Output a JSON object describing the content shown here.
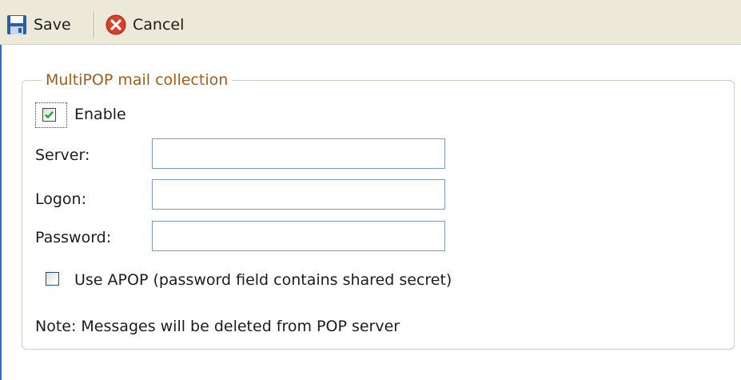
{
  "toolbar": {
    "save_label": "Save",
    "cancel_label": "Cancel"
  },
  "section": {
    "legend": "MultiPOP mail collection"
  },
  "enable": {
    "label": "Enable",
    "checked": true
  },
  "server": {
    "label": "Server:",
    "value": ""
  },
  "logon": {
    "label": "Logon:",
    "value": ""
  },
  "password": {
    "label": "Password:",
    "value": ""
  },
  "apop": {
    "label": "Use APOP (password field contains shared secret)",
    "checked": false
  },
  "note": "Note: Messages will be deleted from POP server",
  "colors": {
    "legend": "#9c5f1a",
    "toolbar_bg": "#ece9d8",
    "checkmark": "#21a121",
    "input_border": "#7f9db9"
  },
  "icons": {
    "save": "floppy-disk-icon",
    "cancel": "cancel-circle-icon"
  }
}
